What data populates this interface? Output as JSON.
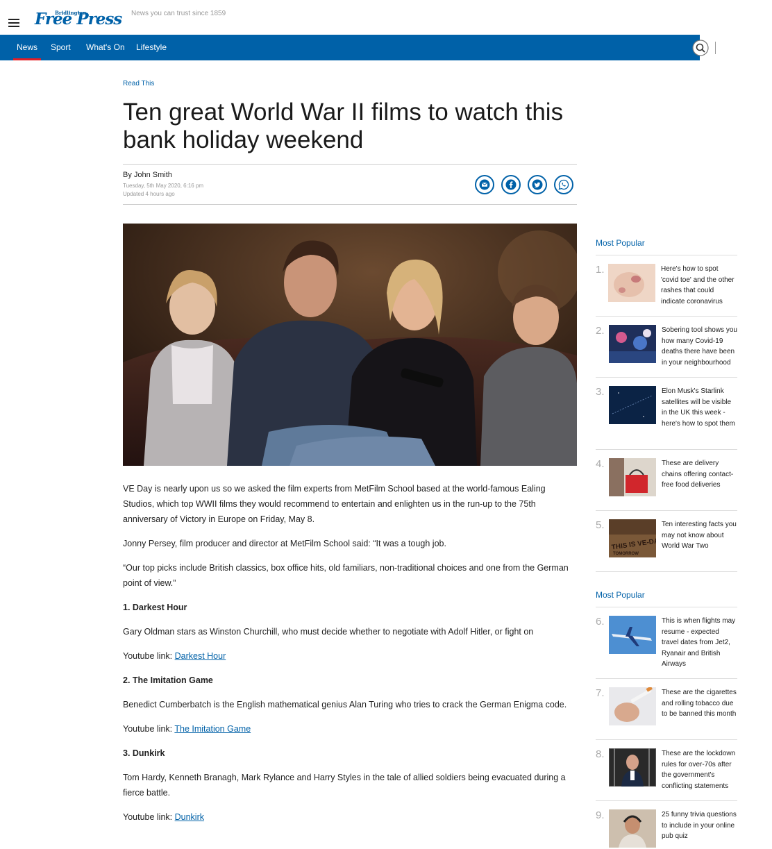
{
  "header": {
    "logo_small": "Bridlington",
    "logo_main": "Free Press",
    "tagline": "News you can trust since 1859",
    "nav": [
      "News",
      "Sport",
      "What's On",
      "Lifestyle"
    ]
  },
  "article": {
    "kicker": "Read This",
    "headline": "Ten great World War II films to watch this bank holiday weekend",
    "byline": "By John Smith",
    "published": "Tuesday, 5th May 2020, 6:16 pm",
    "updated": "Updated  4 hours ago",
    "paragraphs": [
      "VE Day is nearly upon us so we asked the film experts from MetFilm School based at the world-famous Ealing Studios, which top WWII films they would recommend to entertain and enlighten us in the run-up to the 75th anniversary of Victory in Europe on Friday, May 8.",
      "Jonny Persey, film producer and director at MetFilm School said: “It was a tough job.",
      "“Our top picks include British classics, box office hits, old familiars, non-traditional choices and one from the German point of view.”",
      "1. Darkest Hour",
      "Gary Oldman stars as Winston Churchill, who must decide whether to negotiate with Adolf Hitler, or fight on",
      "2. The Imitation Game",
      "Benedict Cumberbatch is the English mathematical genius Alan Turing who tries to crack the German Enigma code.",
      "3. Dunkirk",
      "Tom Hardy, Kenneth Branagh, Mark Rylance and Harry Styles in the tale of allied soldiers being evacuated during a fierce battle."
    ],
    "youtube_prefix": "Youtube link: ",
    "links": [
      "Darkest Hour",
      "The Imitation Game",
      "Dunkirk"
    ]
  },
  "sidebar": {
    "title1": "Most Popular",
    "title2": "Most Popular",
    "items": [
      {
        "num": "1.",
        "text": "Here's how to spot 'covid toe' and the other rashes that could indicate coronavirus"
      },
      {
        "num": "2.",
        "text": "Sobering tool shows you how many Covid-19 deaths there have been in your neighbourhood"
      },
      {
        "num": "3.",
        "text": "Elon Musk's Starlink satellites will be visible in the UK this week - here's how to spot them"
      },
      {
        "num": "4.",
        "text": "These are delivery chains offering contact-free food deliveries"
      },
      {
        "num": "5.",
        "text": "Ten interesting facts you may not know about World War Two"
      },
      {
        "num": "6.",
        "text": "This is when flights may resume - expected travel dates from Jet2, Ryanair and British Airways"
      },
      {
        "num": "7.",
        "text": "These are the cigarettes and rolling tobacco due to be banned this month"
      },
      {
        "num": "8.",
        "text": "These are the lockdown rules for over-70s after the government's conflicting statements"
      },
      {
        "num": "9.",
        "text": "25 funny trivia questions to include in your online pub quiz"
      }
    ],
    "thumb_text_5a": "THIS IS VE-DAY",
    "thumb_text_5b": "TOMORROW"
  },
  "colors": {
    "brand": "#0061a8",
    "accent": "#e21e26"
  }
}
